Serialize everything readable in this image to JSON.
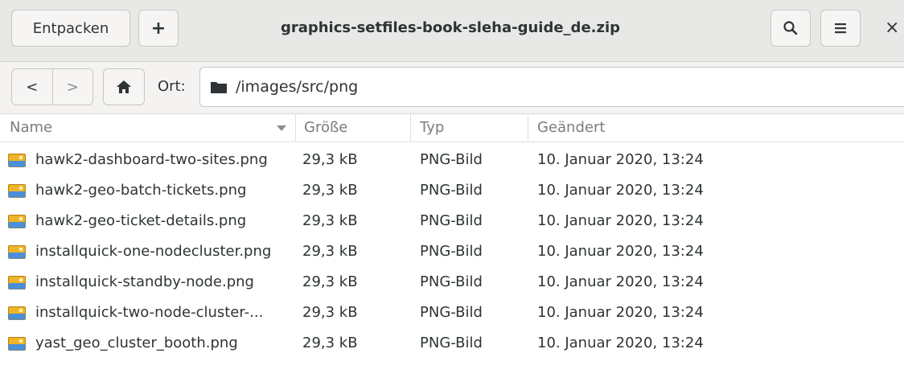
{
  "header": {
    "extract_label": "Entpacken",
    "add_label": "+",
    "title": "graphics-setfiles-book-sleha-guide_de.zip",
    "close_label": "×"
  },
  "pathbar": {
    "back": "<",
    "forward": ">",
    "location_label": "Ort:",
    "path": "/images/src/png"
  },
  "columns": {
    "name": "Name",
    "size": "Größe",
    "type": "Typ",
    "modified": "Geändert"
  },
  "files": [
    {
      "name": "hawk2-dashboard-two-sites.png",
      "size": "29,3 kB",
      "type": "PNG-Bild",
      "modified": "10. Januar 2020, 13:24"
    },
    {
      "name": "hawk2-geo-batch-tickets.png",
      "size": "29,3 kB",
      "type": "PNG-Bild",
      "modified": "10. Januar 2020, 13:24"
    },
    {
      "name": "hawk2-geo-ticket-details.png",
      "size": "29,3 kB",
      "type": "PNG-Bild",
      "modified": "10. Januar 2020, 13:24"
    },
    {
      "name": "installquick-one-nodecluster.png",
      "size": "29,3 kB",
      "type": "PNG-Bild",
      "modified": "10. Januar 2020, 13:24"
    },
    {
      "name": "installquick-standby-node.png",
      "size": "29,3 kB",
      "type": "PNG-Bild",
      "modified": "10. Januar 2020, 13:24"
    },
    {
      "name": "installquick-two-node-cluster-...",
      "size": "29,3 kB",
      "type": "PNG-Bild",
      "modified": "10. Januar 2020, 13:24"
    },
    {
      "name": "yast_geo_cluster_booth.png",
      "size": "29,3 kB",
      "type": "PNG-Bild",
      "modified": "10. Januar 2020, 13:24"
    }
  ]
}
